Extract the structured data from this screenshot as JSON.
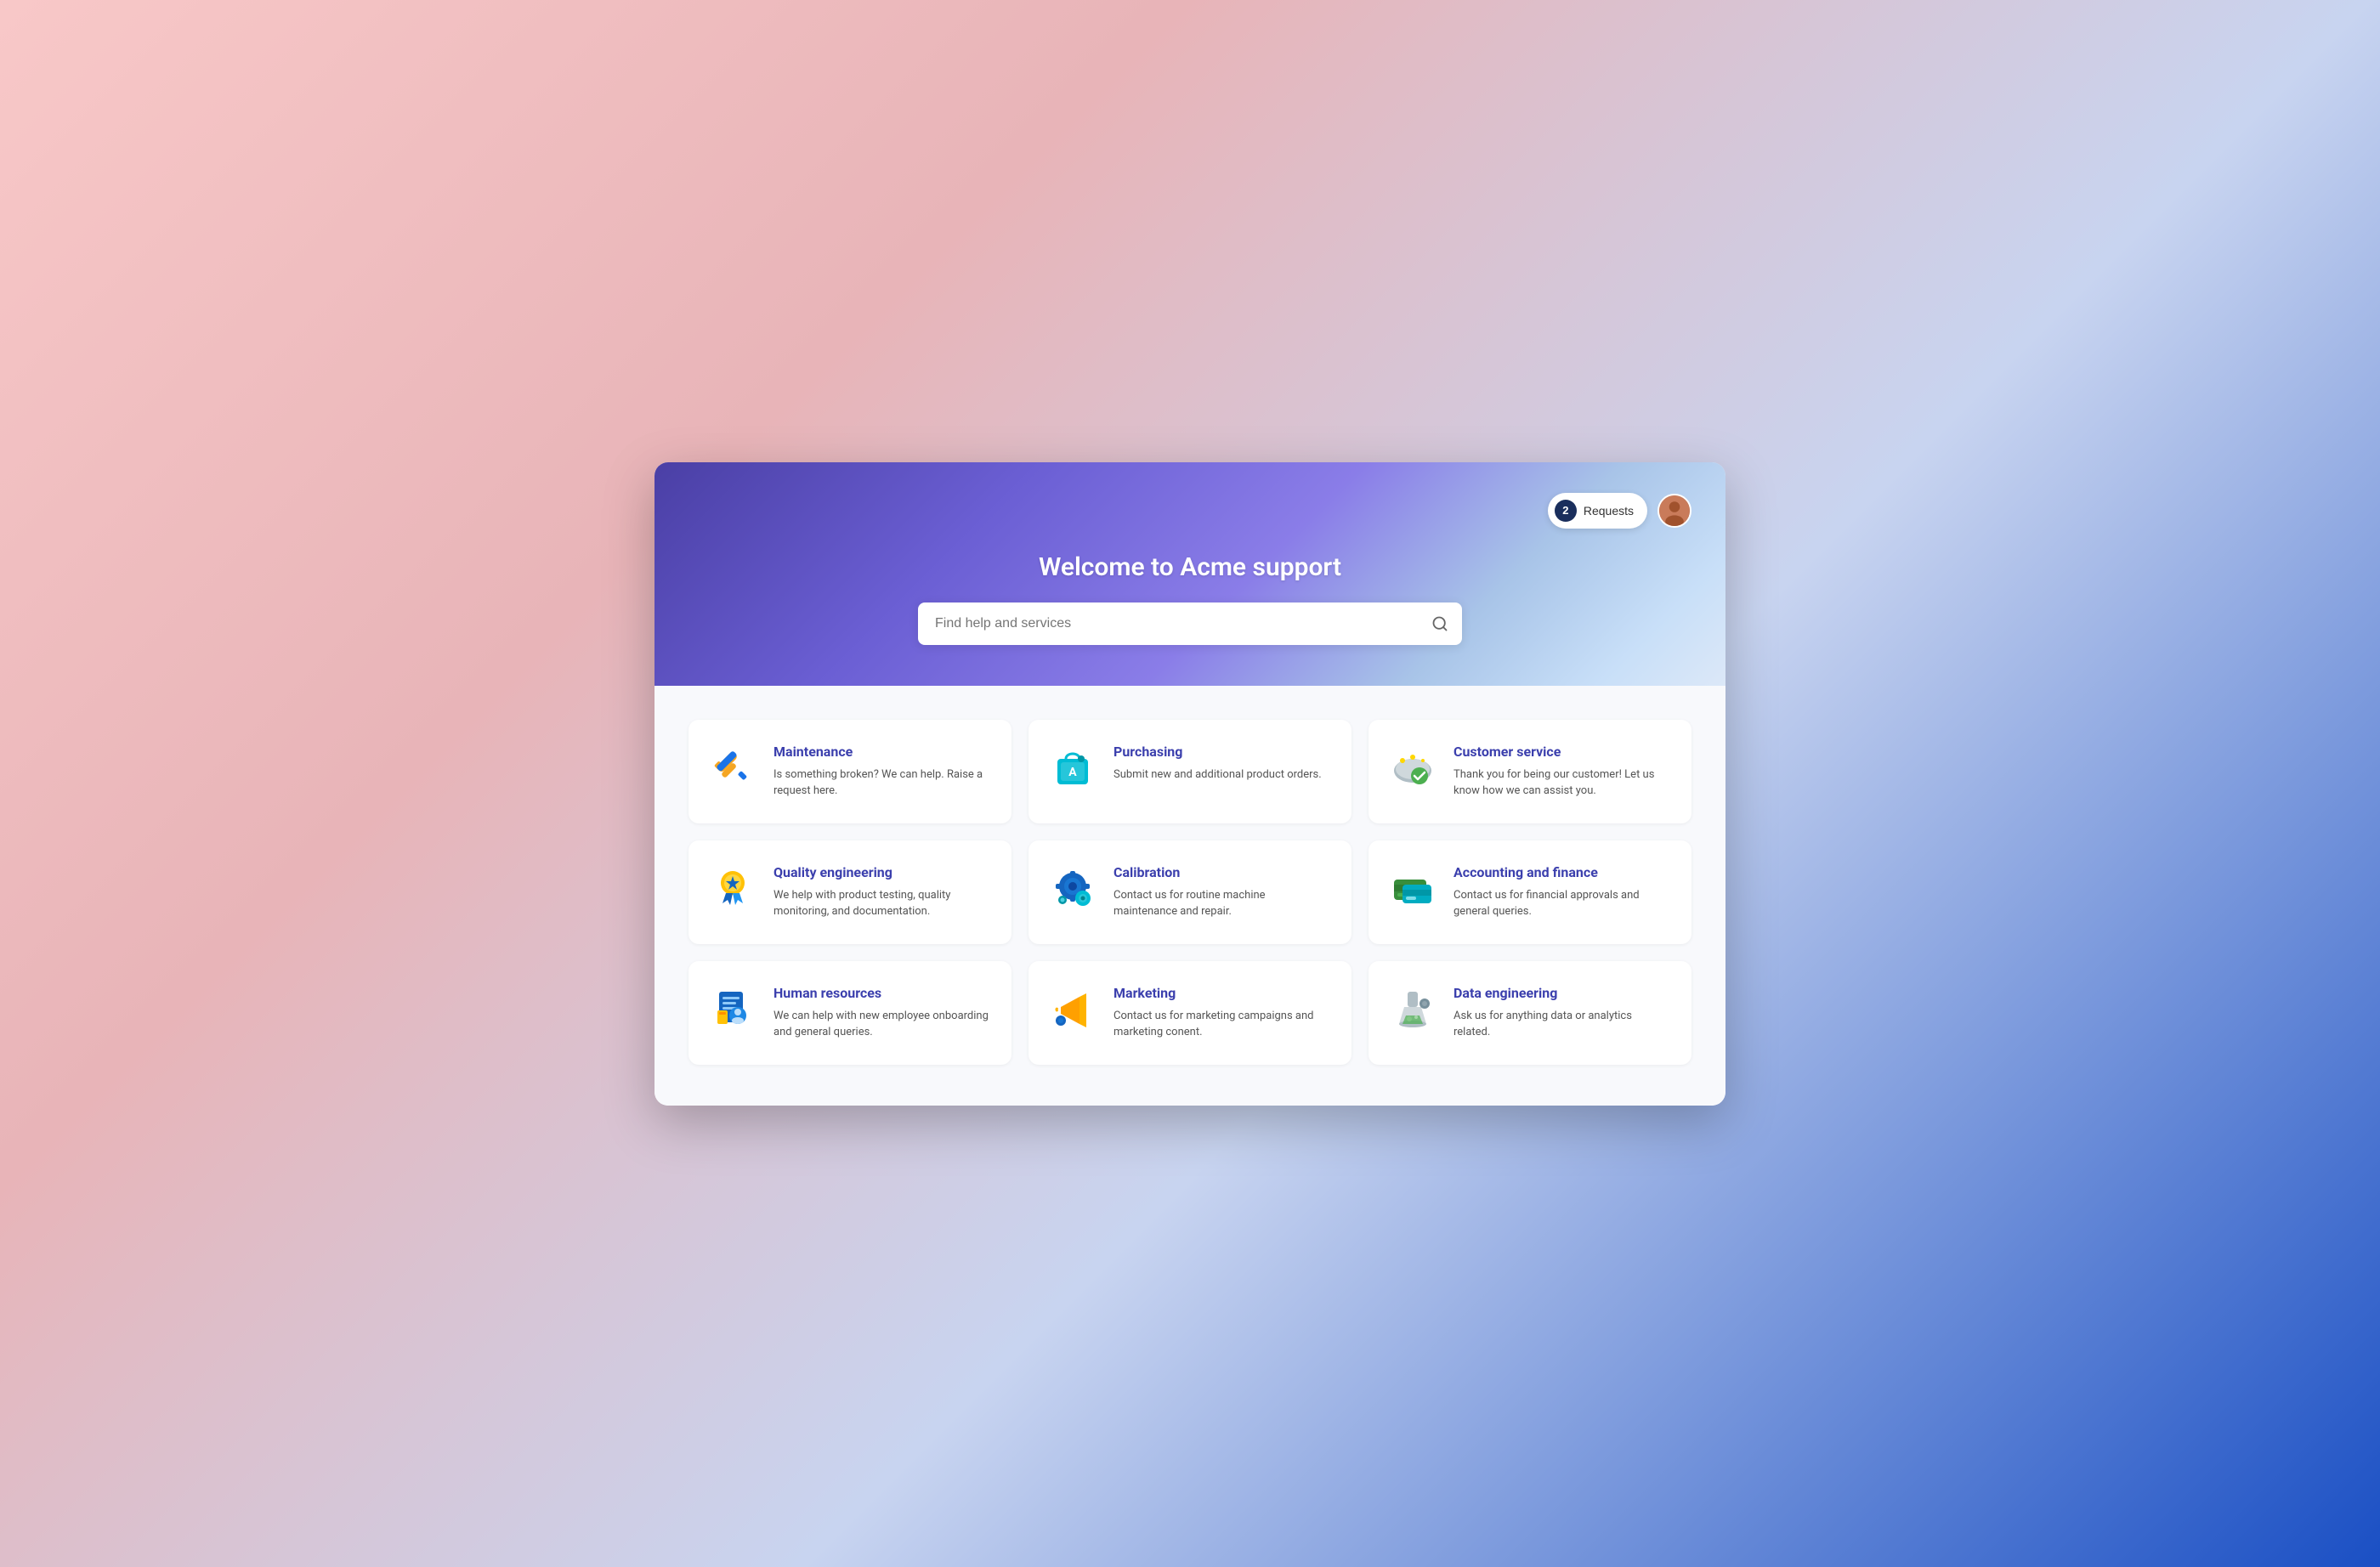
{
  "header": {
    "title": "Welcome to Acme support",
    "search_placeholder": "Find help and services",
    "requests_count": "2",
    "requests_label": "Requests"
  },
  "cards": [
    {
      "id": "maintenance",
      "title": "Maintenance",
      "description": "Is something broken? We can help. Raise a request here.",
      "icon": "maintenance-icon"
    },
    {
      "id": "purchasing",
      "title": "Purchasing",
      "description": "Submit new and additional product orders.",
      "icon": "purchasing-icon"
    },
    {
      "id": "customer-service",
      "title": "Customer service",
      "description": "Thank you for being our customer! Let us know how we can assist you.",
      "icon": "customer-service-icon"
    },
    {
      "id": "quality-engineering",
      "title": "Quality engineering",
      "description": "We help with product testing, quality monitoring, and documentation.",
      "icon": "quality-engineering-icon"
    },
    {
      "id": "calibration",
      "title": "Calibration",
      "description": "Contact us for routine machine maintenance and repair.",
      "icon": "calibration-icon"
    },
    {
      "id": "accounting-finance",
      "title": "Accounting and finance",
      "description": "Contact us for financial approvals and general queries.",
      "icon": "accounting-icon"
    },
    {
      "id": "human-resources",
      "title": "Human resources",
      "description": "We can help with new employee onboarding and general queries.",
      "icon": "hr-icon"
    },
    {
      "id": "marketing",
      "title": "Marketing",
      "description": "Contact us for marketing campaigns and marketing conent.",
      "icon": "marketing-icon"
    },
    {
      "id": "data-engineering",
      "title": "Data engineering",
      "description": "Ask us for anything data or analytics related.",
      "icon": "data-engineering-icon"
    }
  ]
}
